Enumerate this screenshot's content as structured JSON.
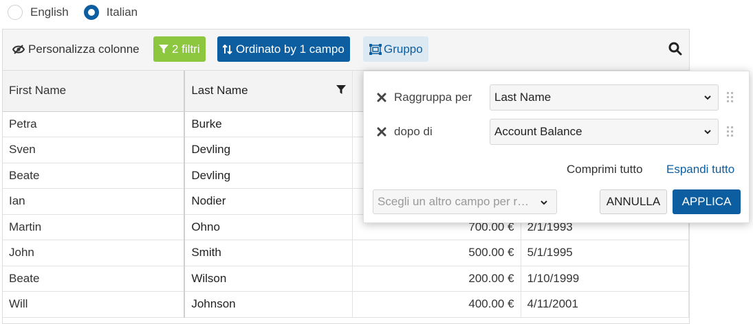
{
  "language": {
    "options": [
      {
        "label": "English",
        "checked": false
      },
      {
        "label": "Italian",
        "checked": true
      }
    ]
  },
  "toolbar": {
    "customize_columns": "Personalizza colonne",
    "filters": "2 filtri",
    "sort": "Ordinato by 1 campo",
    "group": "Gruppo",
    "icons": {
      "columns": "eye-slash-icon",
      "filter": "funnel-icon",
      "sort": "sort-arrows-icon",
      "group": "group-icon",
      "search": "search-icon"
    }
  },
  "table": {
    "headers": [
      "First Name",
      "Last Name",
      "",
      ""
    ],
    "rows": [
      [
        "Petra",
        "Burke",
        "",
        ""
      ],
      [
        "Sven",
        "Devling",
        "",
        ""
      ],
      [
        "Beate",
        "Devling",
        "",
        ""
      ],
      [
        "Ian",
        "Nodier",
        "",
        ""
      ],
      [
        "Martin",
        "Ohno",
        "700.00 €",
        "2/1/1993"
      ],
      [
        "John",
        "Smith",
        "500.00 €",
        "5/1/1995"
      ],
      [
        "Beate",
        "Wilson",
        "200.00 €",
        "1/10/1999"
      ],
      [
        "Will",
        "Johnson",
        "400.00 €",
        "4/11/2001"
      ]
    ]
  },
  "group_popup": {
    "rows": [
      {
        "label": "Raggruppa per",
        "value": "Last Name"
      },
      {
        "label": "dopo di",
        "value": "Account Balance"
      }
    ],
    "collapse_all": "Comprimi tutto",
    "expand_all": "Espandi tutto",
    "add_field_placeholder": "Scegli un altro campo per r…",
    "cancel": "ANNULLA",
    "apply": "APPLICA"
  },
  "colors": {
    "primary": "#0d5ea0",
    "filter_green": "#8dc63f",
    "group_bg": "#dce8f2"
  }
}
